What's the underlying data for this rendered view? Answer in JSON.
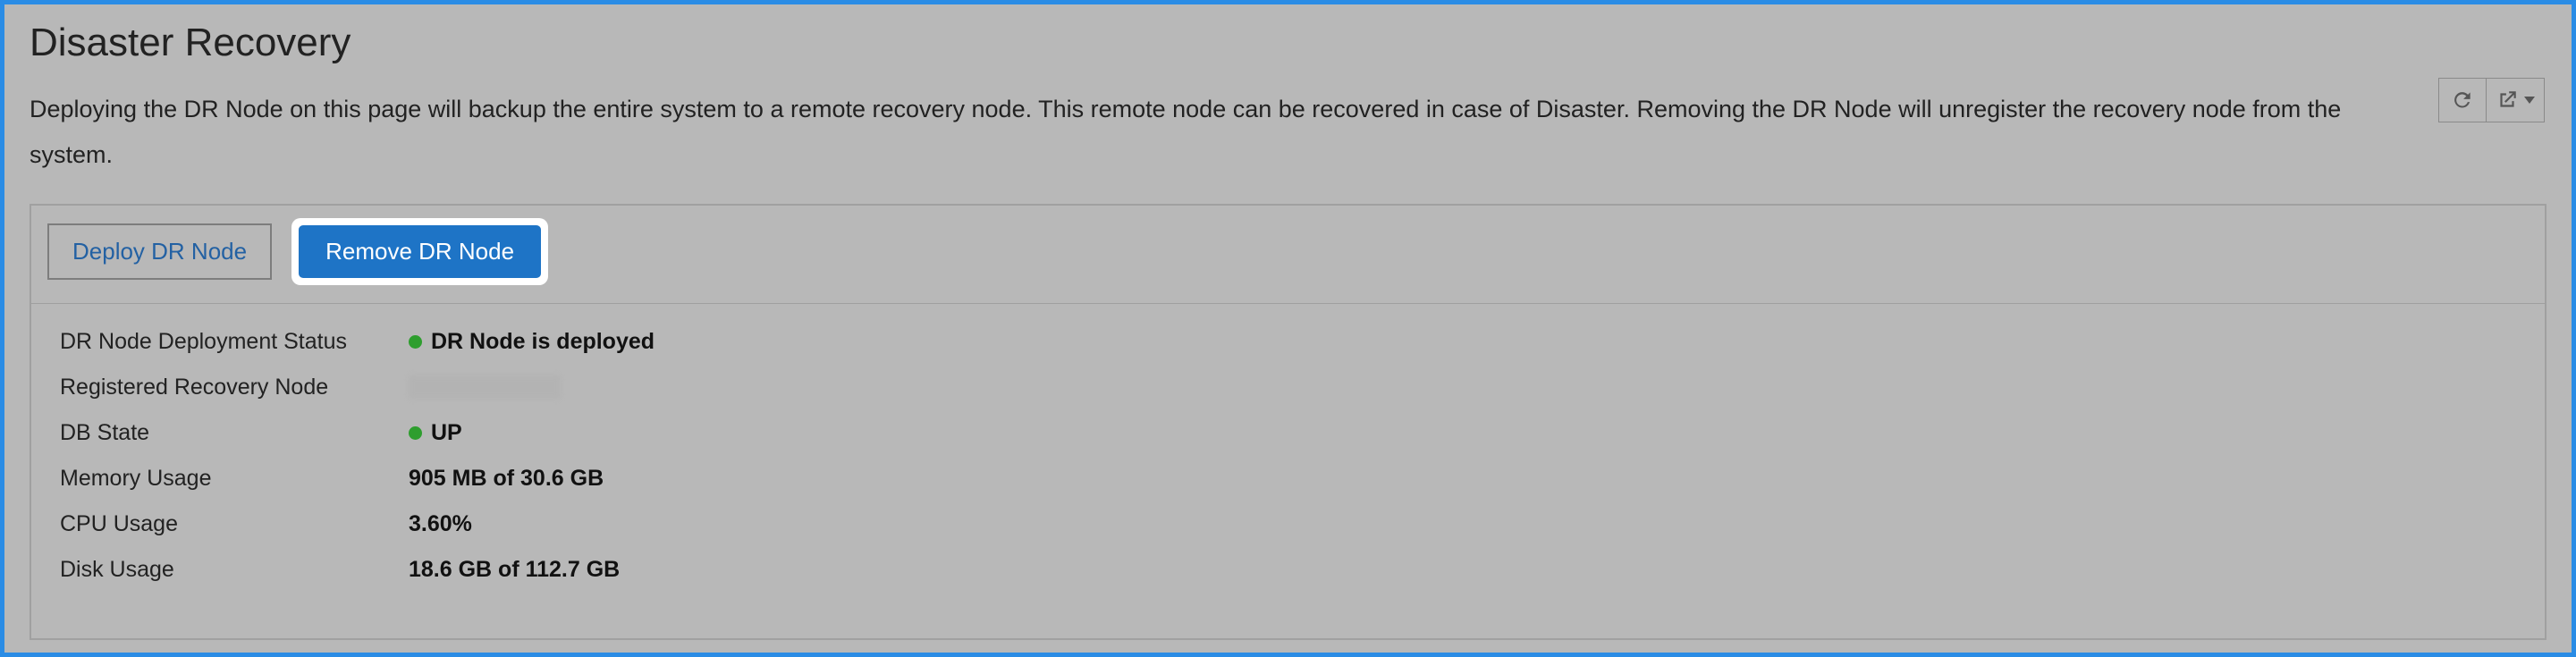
{
  "page": {
    "title": "Disaster Recovery",
    "description": "Deploying the DR Node on this page will backup the entire system to a remote recovery node. This remote node can be recovered in case of Disaster. Removing the DR Node will unregister the recovery node from the system."
  },
  "actions": {
    "refresh": "Refresh",
    "export": "Export"
  },
  "toolbar": {
    "deploy_label": "Deploy DR Node",
    "remove_label": "Remove DR Node"
  },
  "info": {
    "rows": [
      {
        "label": "DR Node Deployment Status",
        "value": "DR Node is deployed",
        "dot": "green"
      },
      {
        "label": "Registered Recovery Node",
        "value": "",
        "blurred": true
      },
      {
        "label": "DB State",
        "value": "UP",
        "dot": "green"
      },
      {
        "label": "Memory Usage",
        "value": "905 MB of 30.6 GB"
      },
      {
        "label": "CPU Usage",
        "value": "3.60%"
      },
      {
        "label": "Disk Usage",
        "value": "18.6 GB of 112.7 GB"
      }
    ]
  }
}
